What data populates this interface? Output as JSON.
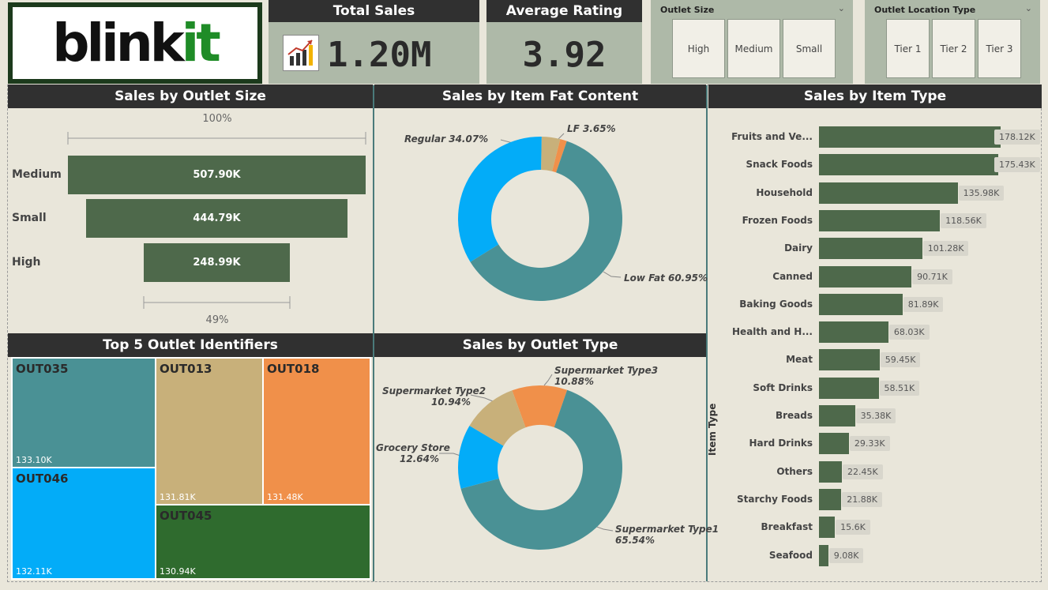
{
  "logo": {
    "text_main": "blink",
    "text_accent": "it"
  },
  "kpis": [
    {
      "title": "Total Sales",
      "value": "1.20M",
      "icon": "chart-growth-icon"
    },
    {
      "title": "Average Rating",
      "value": "3.92"
    }
  ],
  "slicers": [
    {
      "title": "Outlet Size",
      "options": [
        "High",
        "Medium",
        "Small"
      ]
    },
    {
      "title": "Outlet Location Type",
      "options": [
        "Tier 1",
        "Tier 2",
        "Tier 3"
      ]
    }
  ],
  "panels": {
    "outlet_size": "Sales by Outlet Size",
    "fat_content": "Sales by Item Fat Content",
    "item_type": "Sales by Item Type",
    "top5": "Top 5 Outlet Identifiers",
    "outlet_type": "Sales by Outlet Type"
  },
  "colors": {
    "green": "#4e694b",
    "teal": "#4a9195",
    "blue": "#03acf8",
    "tan": "#c8b07a",
    "orange": "#f0904a",
    "dark_green": "#2f6b2e"
  },
  "chart_data": [
    {
      "type": "bar",
      "title": "Sales by Outlet Size",
      "categories": [
        "Medium",
        "Small",
        "High"
      ],
      "values": [
        507.9,
        444.79,
        248.99
      ],
      "value_labels": [
        "507.90K",
        "444.79K",
        "248.99K"
      ],
      "top_percent": "100%",
      "bottom_percent": "49%"
    },
    {
      "type": "pie",
      "title": "Sales by Item Fat Content",
      "categories": [
        "Low Fat",
        "Regular",
        "LF"
      ],
      "values": [
        60.95,
        34.07,
        3.65
      ],
      "labels": [
        "Low Fat 60.95%",
        "Regular 34.07%",
        "LF 3.65%"
      ],
      "colors": [
        "#4a9195",
        "#03acf8",
        "#c8b07a"
      ]
    },
    {
      "type": "bar",
      "title": "Sales by Item Type",
      "ylabel": "Item Type",
      "categories": [
        "Fruits and Ve...",
        "Snack Foods",
        "Household",
        "Frozen Foods",
        "Dairy",
        "Canned",
        "Baking Goods",
        "Health and H...",
        "Meat",
        "Soft Drinks",
        "Breads",
        "Hard Drinks",
        "Others",
        "Starchy Foods",
        "Breakfast",
        "Seafood"
      ],
      "values": [
        178.12,
        175.43,
        135.98,
        118.56,
        101.28,
        90.71,
        81.89,
        68.03,
        59.45,
        58.51,
        35.38,
        29.33,
        22.45,
        21.88,
        15.6,
        9.08
      ],
      "value_labels": [
        "178.12K",
        "175.43K",
        "135.98K",
        "118.56K",
        "101.28K",
        "90.71K",
        "81.89K",
        "68.03K",
        "59.45K",
        "58.51K",
        "35.38K",
        "29.33K",
        "22.45K",
        "21.88K",
        "15.6K",
        "9.08K"
      ]
    },
    {
      "type": "treemap",
      "title": "Top 5 Outlet Identifiers",
      "categories": [
        "OUT035",
        "OUT046",
        "OUT013",
        "OUT018",
        "OUT045"
      ],
      "values": [
        133.1,
        132.11,
        131.81,
        131.48,
        130.94
      ],
      "value_labels": [
        "133.10K",
        "132.11K",
        "131.81K",
        "131.48K",
        "130.94K"
      ]
    },
    {
      "type": "pie",
      "title": "Sales by Outlet Type",
      "categories": [
        "Supermarket Type1",
        "Grocery Store",
        "Supermarket Type2",
        "Supermarket Type3"
      ],
      "values": [
        65.54,
        12.64,
        10.94,
        10.88
      ],
      "labels": [
        [
          "Supermarket Type1",
          "65.54%"
        ],
        [
          "Grocery Store",
          "12.64%"
        ],
        [
          "Supermarket Type2",
          "10.94%"
        ],
        [
          "Supermarket Type3",
          "10.88%"
        ]
      ],
      "colors": [
        "#4a9195",
        "#03acf8",
        "#c8b07a",
        "#f0904a"
      ]
    }
  ]
}
